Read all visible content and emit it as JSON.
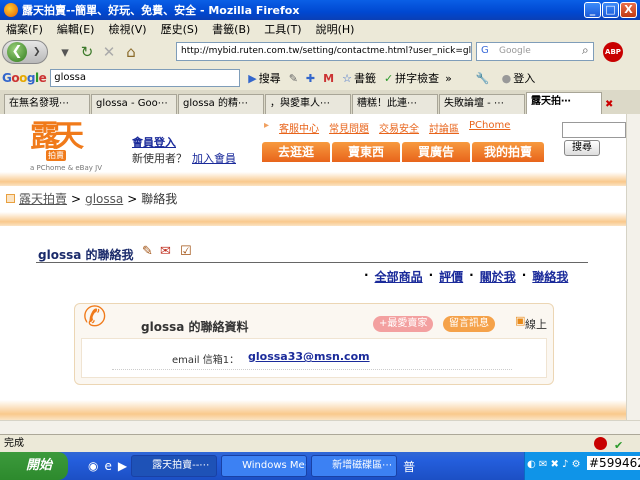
{
  "window": {
    "title": "露天拍賣--簡單、好玩、免費、安全 - Mozilla Firefox",
    "btn_min": "_",
    "btn_max": "□",
    "btn_close": "X"
  },
  "menubar": {
    "items": [
      "檔案(F)",
      "編輯(E)",
      "檢視(V)",
      "歷史(S)",
      "書籤(B)",
      "工具(T)",
      "說明(H)"
    ]
  },
  "navbar": {
    "url": "http://mybid.ruten.com.tw/setting/contactme.html?user_nick=glos",
    "search_placeholder": "Google",
    "abp": "ABP",
    "icons": [
      "back-icon",
      "forward-icon",
      "reload-icon",
      "stop-icon",
      "home-icon"
    ]
  },
  "google_toolbar": {
    "logo": "Google",
    "query": "glossa",
    "search_label": "搜尋",
    "bookmarks_label": "書籤",
    "spell_label": "拼字檢查",
    "more": "»",
    "login_label": "登入"
  },
  "tabs": [
    {
      "label": "在無名發現⋯"
    },
    {
      "label": "glossa - Goo⋯"
    },
    {
      "label": "glossa 的精⋯"
    },
    {
      "label": "，與愛車人⋯"
    },
    {
      "label": "糟糕！此連⋯"
    },
    {
      "label": "失敗論壇 - ⋯"
    },
    {
      "label": "露天拍⋯"
    }
  ],
  "site": {
    "logo_text": "露天",
    "logo_sub": "拍賣",
    "logo_caption": "a PChome & eBay JV",
    "login": "會員登入",
    "newuser": "新使用者？",
    "join": "加入會員",
    "toplinks": [
      "客服中心",
      "常見問題",
      "交易安全",
      "討論區",
      "PChome"
    ],
    "navbtns": [
      "去逛逛",
      "賣東西",
      "買廣告",
      "我的拍賣"
    ],
    "search_btn": "搜尋"
  },
  "breadcrumb": {
    "items": [
      "露天拍賣",
      "glossa",
      "聯絡我"
    ],
    "sep": ">"
  },
  "page": {
    "heading": "glossa 的聯絡我",
    "links": [
      "全部商品",
      "評價",
      "關於我",
      "聯絡我"
    ],
    "card_title": "glossa 的聯絡資料",
    "badge_fav": "+最愛賣家",
    "badge_msg": "留言訊息",
    "online": "線上",
    "email_label": "email 信箱1：",
    "email_value": "glossa33@msn.com"
  },
  "status": {
    "text": "完成"
  },
  "taskbar": {
    "start": "開始",
    "tasks": [
      "露天拍賣--⋯",
      "Windows Me⋯",
      "新增磁碟區⋯"
    ],
    "ime": "普",
    "watermark": "#599462"
  }
}
